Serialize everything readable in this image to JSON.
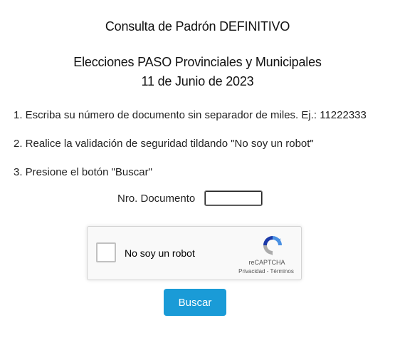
{
  "header": {
    "title": "Consulta de Padrón DEFINITIVO",
    "subtitle_line1": "Elecciones PASO Provinciales y Municipales",
    "subtitle_line2": "11 de Junio de 2023"
  },
  "instructions": {
    "step1": "1. Escriba su número de documento sin separador de miles. Ej.: 11222333",
    "step2": "2. Realice la validación de seguridad tildando \"No soy un robot\"",
    "step3": "3. Presione el botón \"Buscar\""
  },
  "form": {
    "document_label": "Nro. Documento",
    "document_value": "",
    "submit_label": "Buscar"
  },
  "captcha": {
    "label": "No soy un robot",
    "brand": "reCAPTCHA",
    "privacy": "Privacidad",
    "separator": " - ",
    "terms": "Términos",
    "logo_icon": "recaptcha-logo-icon",
    "checked": false
  },
  "colors": {
    "button_bg": "#1a9bd7",
    "button_text": "#ffffff",
    "captcha_bg": "#f9f9f9"
  }
}
